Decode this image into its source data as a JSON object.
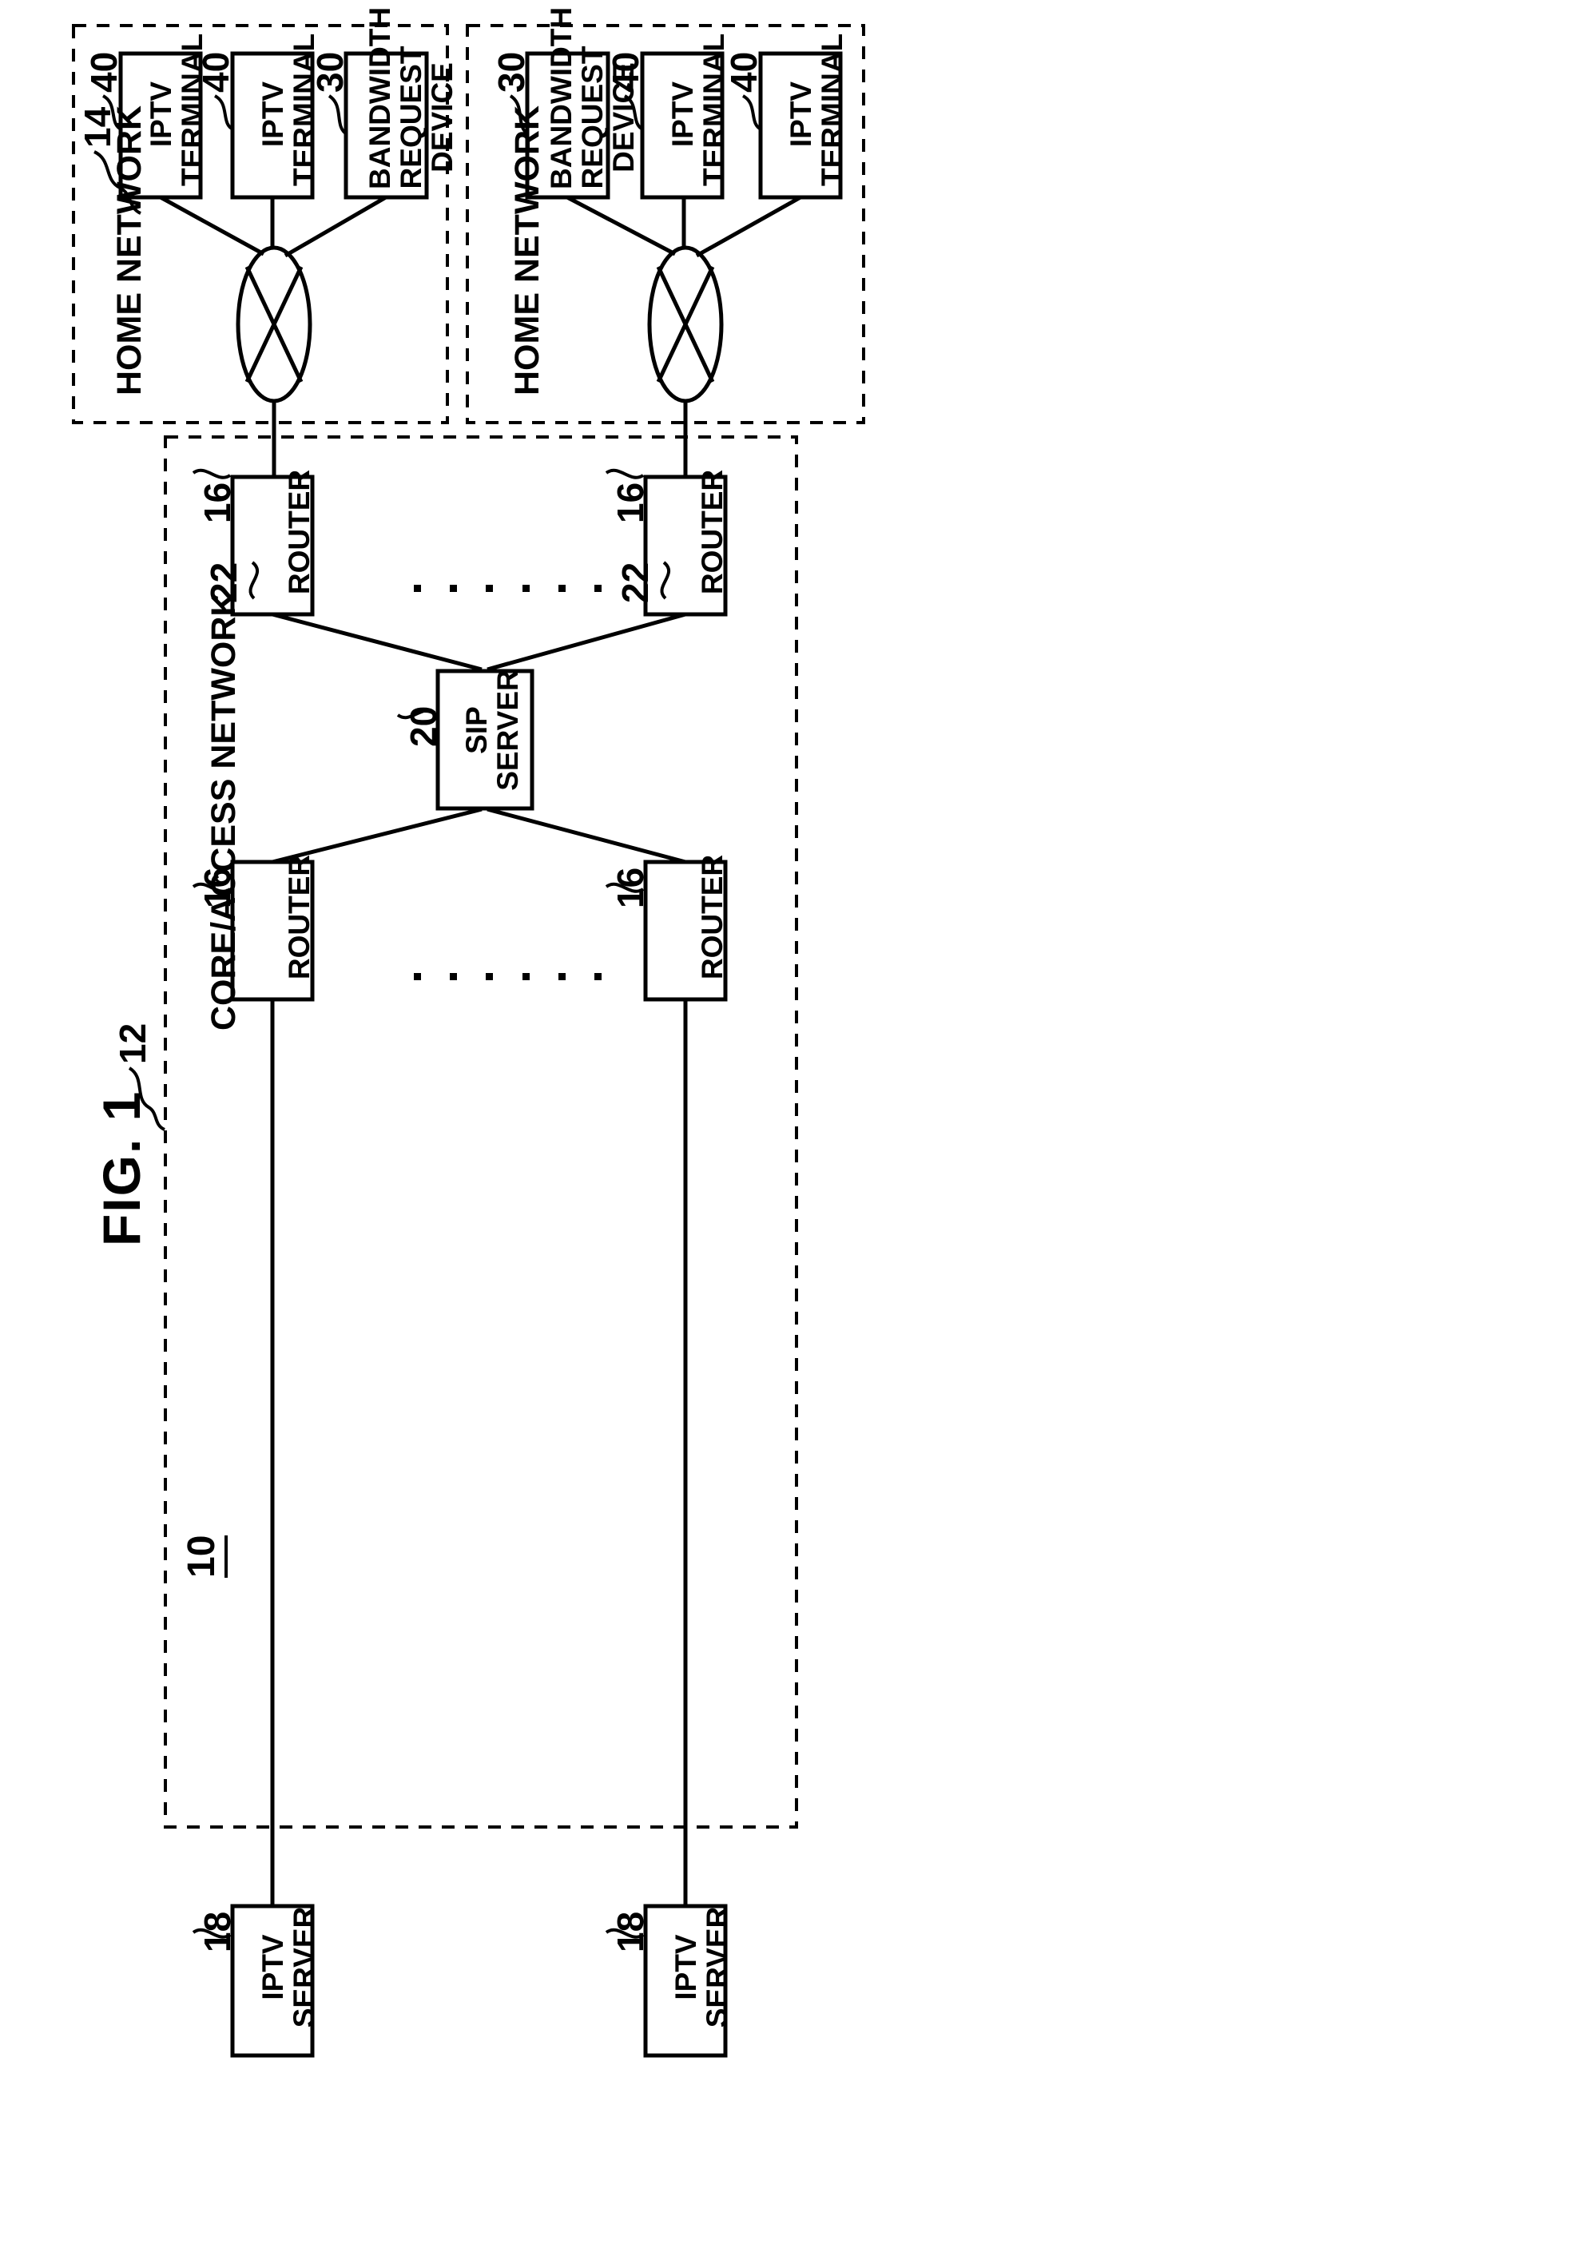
{
  "figure": {
    "title": "FIG. 1",
    "system_reference": "10"
  },
  "zones": [
    {
      "id": "home-network-top",
      "label": "HOME NETWORK",
      "reference": "14"
    },
    {
      "id": "home-network-bottom",
      "label": "HOME NETWORK",
      "reference": ""
    },
    {
      "id": "core-access-network",
      "label": "CORE/ACCESS NETWORK",
      "reference": "12"
    }
  ],
  "nodes": {
    "hn1_iptv_terminal_1": {
      "label_line1": "IPTV",
      "label_line2": "TERMINAL",
      "reference": "40"
    },
    "hn1_iptv_terminal_2": {
      "label_line1": "IPTV",
      "label_line2": "TERMINAL",
      "reference": "40"
    },
    "hn1_bandwidth_request_device": {
      "label_line1": "BANDWIDTH",
      "label_line2": "REQUEST",
      "label_line3": "DEVICE",
      "reference": "30"
    },
    "hn1_switch": {
      "reference": "22"
    },
    "hn2_bandwidth_request_device": {
      "label_line1": "BANDWIDTH",
      "label_line2": "REQUEST",
      "label_line3": "DEVICE",
      "reference": "30"
    },
    "hn2_iptv_terminal_1": {
      "label_line1": "IPTV",
      "label_line2": "TERMINAL",
      "reference": "40"
    },
    "hn2_iptv_terminal_2": {
      "label_line1": "IPTV",
      "label_line2": "TERMINAL",
      "reference": "40"
    },
    "hn2_switch": {
      "reference": "22"
    },
    "router_top_right": {
      "label": "ROUTER",
      "reference": "16"
    },
    "router_bottom_right": {
      "label": "ROUTER",
      "reference": "16"
    },
    "router_top_left": {
      "label": "ROUTER",
      "reference": "16"
    },
    "router_bottom_left": {
      "label": "ROUTER",
      "reference": "16"
    },
    "sip_server": {
      "label_line1": "SIP",
      "label_line2": "SERVER",
      "reference": "20"
    },
    "iptv_server_top": {
      "label_line1": "IPTV",
      "label_line2": "SERVER",
      "reference": "18"
    },
    "iptv_server_bottom": {
      "label_line1": "IPTV",
      "label_line2": "SERVER",
      "reference": "18"
    }
  },
  "ellipsis": {
    "upper": "· · · · · ·",
    "lower": "· · · · · ·"
  },
  "colors": {
    "stroke": "#000000",
    "background": "#ffffff"
  }
}
